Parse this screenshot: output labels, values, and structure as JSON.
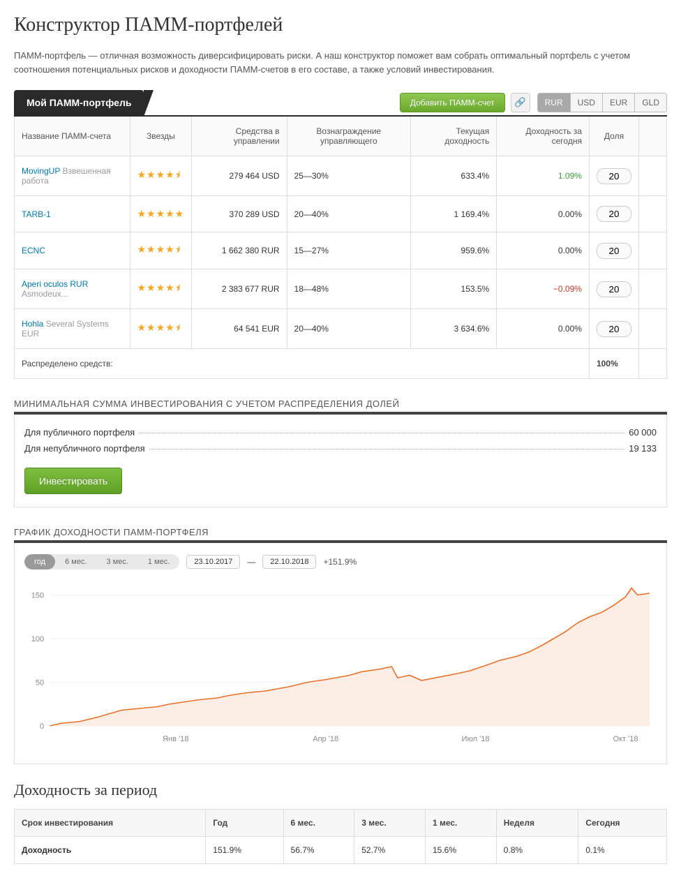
{
  "page_title": "Конструктор ПАММ-портфелей",
  "intro": "ПАММ-портфель — отличная возможность диверсифицировать риски. А наш конструктор поможет вам собрать оптимальный портфель с учетом соотношения потенциальных рисков и доходности ПАММ-счетов в его составе, а также условий инвестирования.",
  "tab_label": "Мой ПАММ-портфель",
  "add_button": "Добавить ПАММ-счет",
  "currencies": [
    "RUR",
    "USD",
    "EUR",
    "GLD"
  ],
  "active_currency": "RUR",
  "columns": {
    "name": "Название ПАММ-счета",
    "stars": "Звезды",
    "funds": "Средства в управлении",
    "fee": "Вознаграждение управляющего",
    "return": "Текущая доходность",
    "today": "Доходность за сегодня",
    "share": "Доля"
  },
  "rows": [
    {
      "name": "MovingUP",
      "sub": "Взвешенная работа",
      "stars": 4.5,
      "funds": "279 464 USD",
      "fee": "25—30%",
      "ret": "633.4%",
      "today": "1.09%",
      "today_cls": "pos",
      "share": "20"
    },
    {
      "name": "TARB-1",
      "sub": "",
      "stars": 5,
      "funds": "370 289 USD",
      "fee": "20—40%",
      "ret": "1 169.4%",
      "today": "0.00%",
      "today_cls": "",
      "share": "20"
    },
    {
      "name": "ECNC",
      "sub": "",
      "stars": 4.5,
      "funds": "1 662 380 RUR",
      "fee": "15—27%",
      "ret": "959.6%",
      "today": "0.00%",
      "today_cls": "",
      "share": "20"
    },
    {
      "name": "Aperi oculos RUR",
      "sub": "Asmodeux...",
      "stars": 4.5,
      "funds": "2 383 677 RUR",
      "fee": "18—48%",
      "ret": "153.5%",
      "today": "−0.09%",
      "today_cls": "neg",
      "share": "20"
    },
    {
      "name": "Hohla",
      "sub": "Several Systems EUR",
      "stars": 4.5,
      "funds": "64 541 EUR",
      "fee": "20—40%",
      "ret": "3 634.6%",
      "today": "0.00%",
      "today_cls": "",
      "share": "20"
    }
  ],
  "distributed_label": "Распределено средств:",
  "distributed_total": "100%",
  "min_invest_heading": "МИНИМАЛЬНАЯ СУММА ИНВЕСТИРОВАНИЯ С УЧЕТОМ РАСПРЕДЕЛЕНИЯ ДОЛЕЙ",
  "min_public_label": "Для публичного портфеля",
  "min_public_val": "60 000",
  "min_private_label": "Для непубличного портфеля",
  "min_private_val": "19 133",
  "invest_button": "Инвестировать",
  "chart_heading": "ГРАФИК ДОХОДНОСТИ ПАММ-ПОРТФЕЛЯ",
  "periods": [
    "год",
    "6 мес.",
    "3 мес.",
    "1 мес."
  ],
  "active_period": "год",
  "date_from": "23.10.2017",
  "date_to": "22.10.2018",
  "chart_change": "+151.9%",
  "xticks": [
    "Янв '18",
    "Апр '18",
    "Июл '18",
    "Окт '18"
  ],
  "yticks": [
    "0",
    "50",
    "100",
    "150"
  ],
  "period_heading": "Доходность за период",
  "period_table": {
    "header": [
      "Срок инвестирования",
      "Год",
      "6 мес.",
      "3 мес.",
      "1 мес.",
      "Неделя",
      "Сегодня"
    ],
    "row_label": "Доходность",
    "values": [
      "151.9%",
      "56.7%",
      "52.7%",
      "15.6%",
      "0.8%",
      "0.1%"
    ]
  },
  "chart_data": {
    "type": "area",
    "title": "График доходности ПАММ-портфеля",
    "xlabel": "",
    "ylabel": "",
    "ylim": [
      0,
      160
    ],
    "x_range": [
      "2017-10-23",
      "2018-10-22"
    ],
    "x_ticks": [
      "Янв '18",
      "Апр '18",
      "Июл '18",
      "Окт '18"
    ],
    "series": [
      {
        "name": "Доходность",
        "color": "#e8702a",
        "x": [
          0,
          0.02,
          0.05,
          0.08,
          0.12,
          0.15,
          0.18,
          0.2,
          0.22,
          0.25,
          0.28,
          0.3,
          0.33,
          0.36,
          0.4,
          0.43,
          0.46,
          0.5,
          0.52,
          0.55,
          0.57,
          0.58,
          0.6,
          0.62,
          0.65,
          0.68,
          0.7,
          0.73,
          0.75,
          0.78,
          0.8,
          0.82,
          0.84,
          0.86,
          0.88,
          0.9,
          0.92,
          0.94,
          0.96,
          0.97,
          0.98,
          1.0
        ],
        "values": [
          0,
          3,
          5,
          10,
          18,
          20,
          22,
          25,
          27,
          30,
          32,
          35,
          38,
          40,
          45,
          50,
          53,
          58,
          62,
          65,
          68,
          55,
          58,
          52,
          56,
          60,
          63,
          70,
          75,
          80,
          85,
          92,
          100,
          108,
          118,
          125,
          130,
          138,
          148,
          158,
          150,
          152
        ]
      }
    ]
  }
}
